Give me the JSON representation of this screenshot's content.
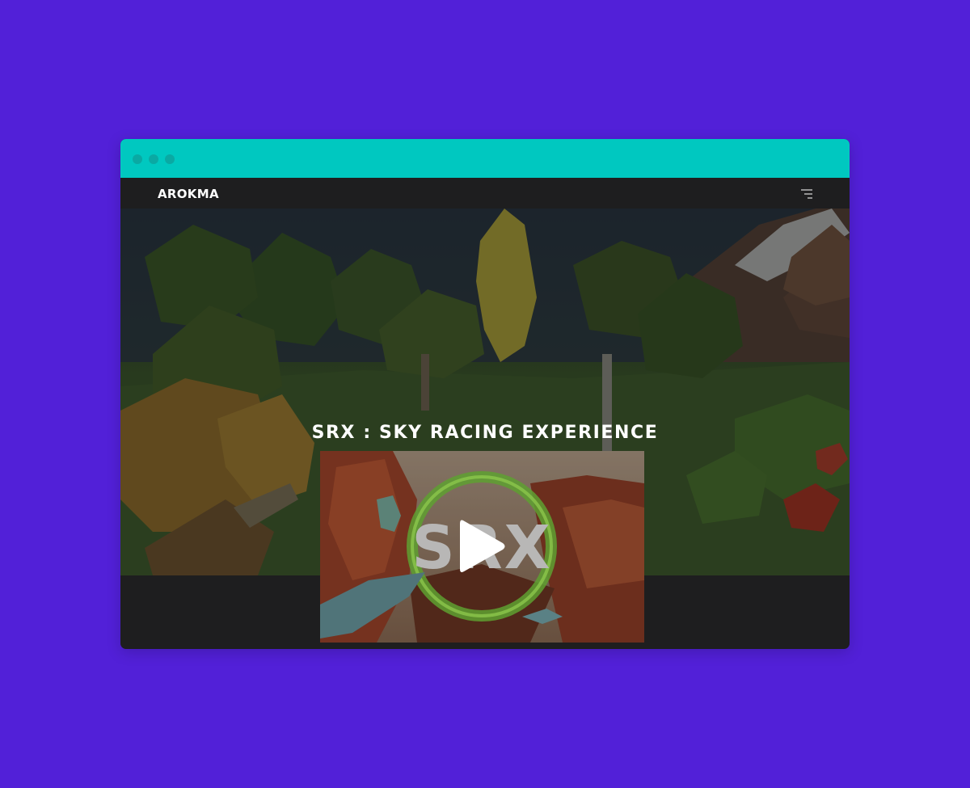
{
  "browser": {
    "window_controls": [
      "close",
      "minimize",
      "maximize"
    ]
  },
  "navbar": {
    "brand": "AROKMA",
    "menu_icon": "hamburger-menu-icon"
  },
  "hero": {
    "title": "SRX : SKY RACING EXPERIENCE",
    "video": {
      "logo_text": "SRX",
      "play_icon": "play-icon"
    }
  },
  "colors": {
    "page_background": "#5220d8",
    "titlebar": "#00c8c0",
    "titlebar_dots": "#0aa9a3",
    "navbar": "#1e1e1f",
    "text": "#ffffff"
  }
}
